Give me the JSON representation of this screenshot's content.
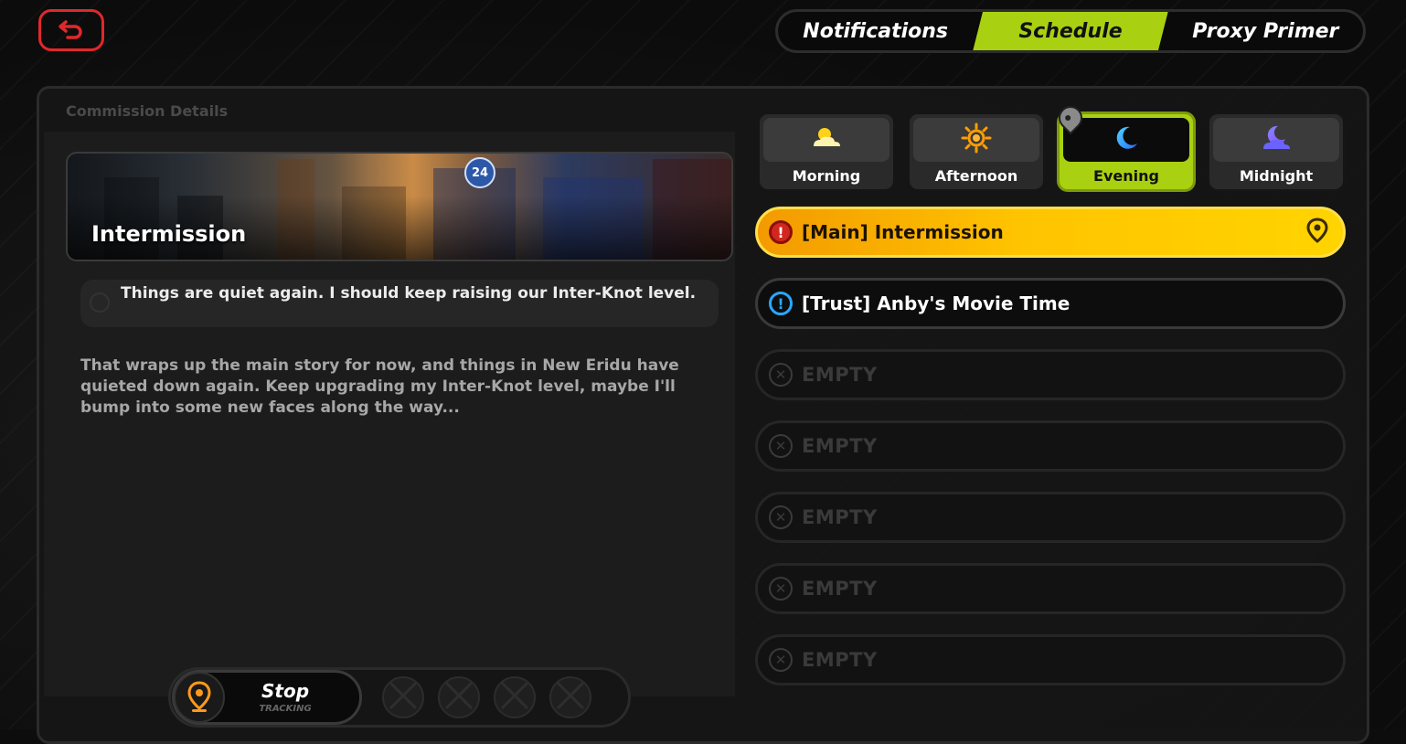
{
  "header": {
    "tabs": [
      {
        "label": "Notifications",
        "active": false
      },
      {
        "label": "Schedule",
        "active": true
      },
      {
        "label": "Proxy Primer",
        "active": false
      }
    ]
  },
  "panel": {
    "title": "Commission Details"
  },
  "commission": {
    "banner_title": "Intermission",
    "banner_sign": "24",
    "objective": "Things are quiet again. I should keep raising our Inter-Knot level.",
    "description": "That wraps up the main story for now, and things in New Eridu have quieted down again. Keep upgrading my Inter-Knot level, maybe I'll bump into some new faces along the way..."
  },
  "tracking": {
    "stop_label": "Stop",
    "stop_sub": "TRACKING"
  },
  "time_slots": [
    {
      "label": "Morning",
      "icon": "sun-cloud-icon",
      "active": false
    },
    {
      "label": "Afternoon",
      "icon": "sun-icon",
      "active": false
    },
    {
      "label": "Evening",
      "icon": "moon-icon",
      "active": true
    },
    {
      "label": "Midnight",
      "icon": "moon-cloud-icon",
      "active": false
    }
  ],
  "quests": [
    {
      "label": "[Main] Intermission",
      "type": "main"
    },
    {
      "label": "[Trust] Anby's Movie Time",
      "type": "trust"
    },
    {
      "label": "EMPTY",
      "type": "empty"
    },
    {
      "label": "EMPTY",
      "type": "empty"
    },
    {
      "label": "EMPTY",
      "type": "empty"
    },
    {
      "label": "EMPTY",
      "type": "empty"
    },
    {
      "label": "EMPTY",
      "type": "empty"
    }
  ],
  "colors": {
    "accent_green": "#a9d111",
    "main_quest_yellow": "#ffc400",
    "trust_blue": "#29a8ff",
    "back_red": "#e0282b",
    "tracking_orange": "#ff9a1a"
  }
}
